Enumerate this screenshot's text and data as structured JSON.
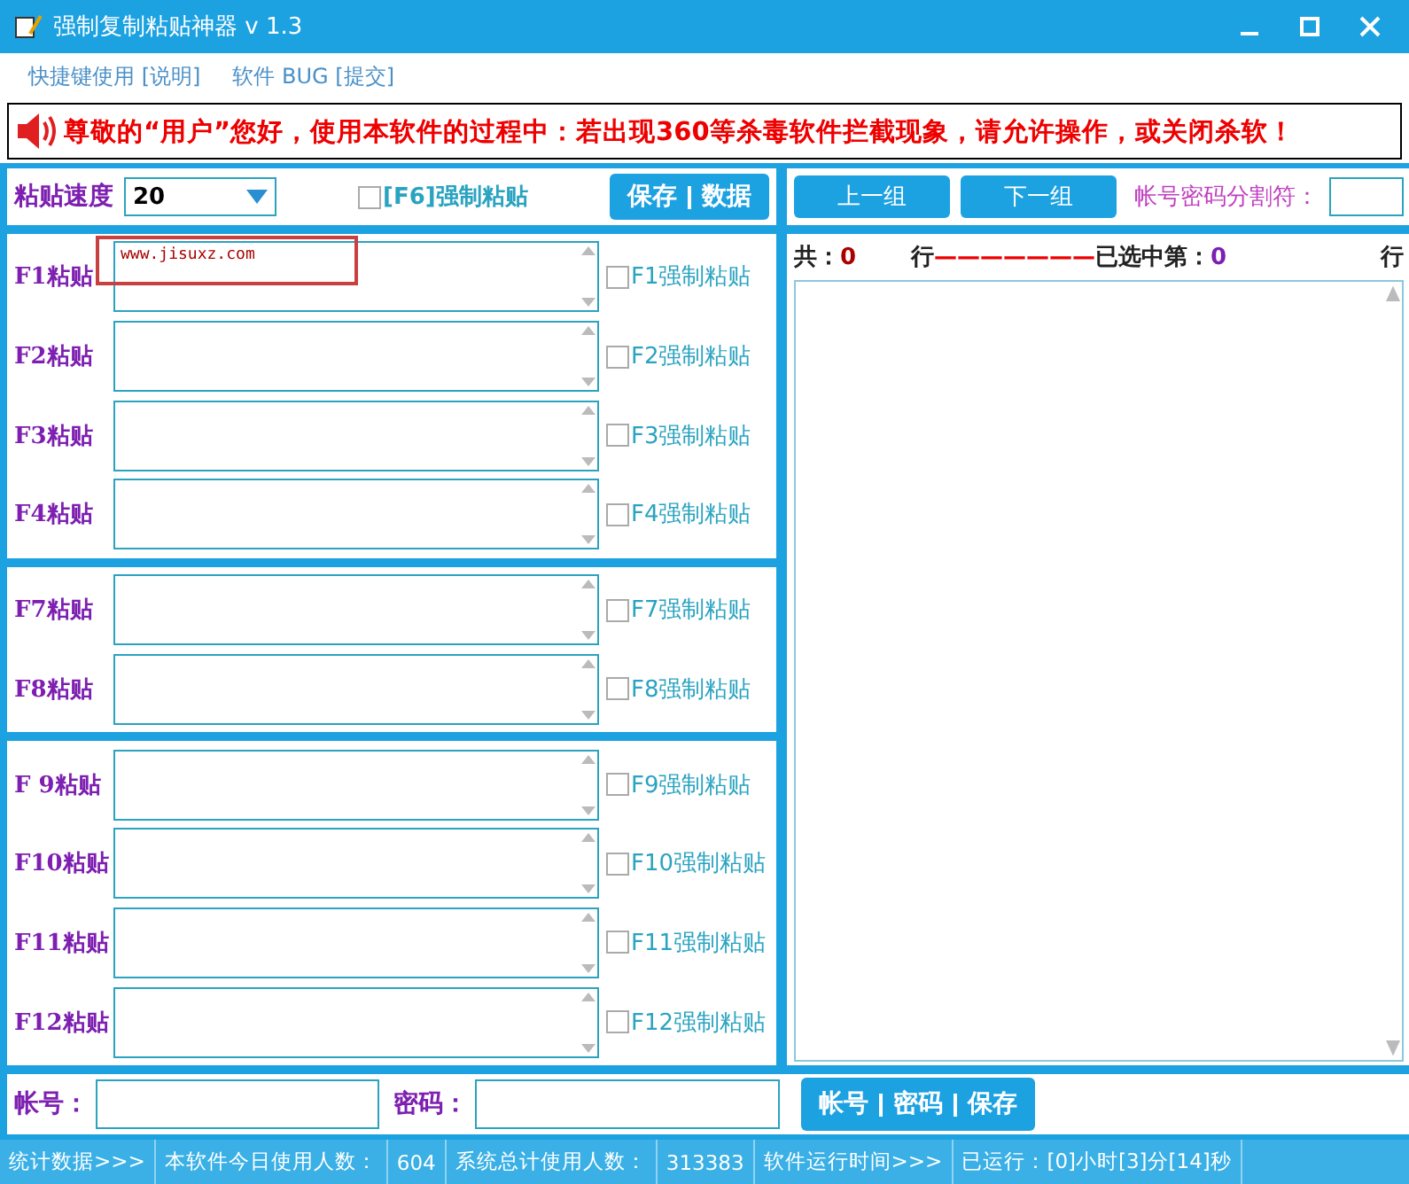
{
  "window": {
    "title": "强制复制粘贴神器 v 1.3"
  },
  "menu": [
    {
      "label": "快捷键使用 [说明]"
    },
    {
      "label": "软件 BUG  [提交]"
    }
  ],
  "notice": "尊敬的“用户”您好，使用本软件的过程中：若出现360等杀毒软件拦截现象，请允许操作，或关闭杀软！",
  "left_toolbar": {
    "speed_label": "粘贴速度",
    "speed_value": "20",
    "force_label": "[F6]强制粘贴",
    "force_checked": false,
    "buttons": [
      "保存",
      "数据"
    ]
  },
  "groups": [
    {
      "rows": [
        {
          "label": "F1粘贴",
          "value": "www.jisuxz.com",
          "highlighted": true,
          "check_label": "F1强制粘贴",
          "checked": false
        },
        {
          "label": "F2粘贴",
          "value": "",
          "highlighted": false,
          "check_label": "F2强制粘贴",
          "checked": false
        },
        {
          "label": "F3粘贴",
          "value": "",
          "highlighted": false,
          "check_label": "F3强制粘贴",
          "checked": false
        },
        {
          "label": "F4粘贴",
          "value": "",
          "highlighted": false,
          "check_label": "F4强制粘贴",
          "checked": false
        }
      ]
    },
    {
      "rows": [
        {
          "label": "F7粘贴",
          "value": "",
          "highlighted": false,
          "check_label": "F7强制粘贴",
          "checked": false
        },
        {
          "label": "F8粘贴",
          "value": "",
          "highlighted": false,
          "check_label": "F8强制粘贴",
          "checked": false
        }
      ]
    },
    {
      "rows": [
        {
          "label": "F 9粘贴",
          "value": "",
          "highlighted": false,
          "check_label": "F9强制粘贴",
          "checked": false
        },
        {
          "label": "F10粘贴",
          "value": "",
          "highlighted": false,
          "check_label": "F10强制粘贴",
          "checked": false
        },
        {
          "label": "F11粘贴",
          "value": "",
          "highlighted": false,
          "check_label": "F11强制粘贴",
          "checked": false
        },
        {
          "label": "F12粘贴",
          "value": "",
          "highlighted": false,
          "check_label": "F12强制粘贴",
          "checked": false
        }
      ]
    }
  ],
  "right_toolbar": {
    "buttons": [
      "上一组",
      "下一组"
    ],
    "separator_label": "帐号密码分割符："
  },
  "list": {
    "total_label": "共：",
    "total": "0",
    "row_unit": "行",
    "dashes": "———————",
    "selected_label": "已选中第：",
    "selected": "0",
    "selected_unit": "行"
  },
  "bottom": {
    "account_label": "帐号：",
    "password_label": "密码：",
    "buttons": [
      "帐号",
      "密码",
      "保存"
    ]
  },
  "status_bar": [
    "统计数据>>>",
    "本软件今日使用人数：",
    "604",
    "系统总计使用人数：",
    "313383",
    "软件运行时间>>>",
    "已运行：[0]小时[3]分[14]秒"
  ]
}
